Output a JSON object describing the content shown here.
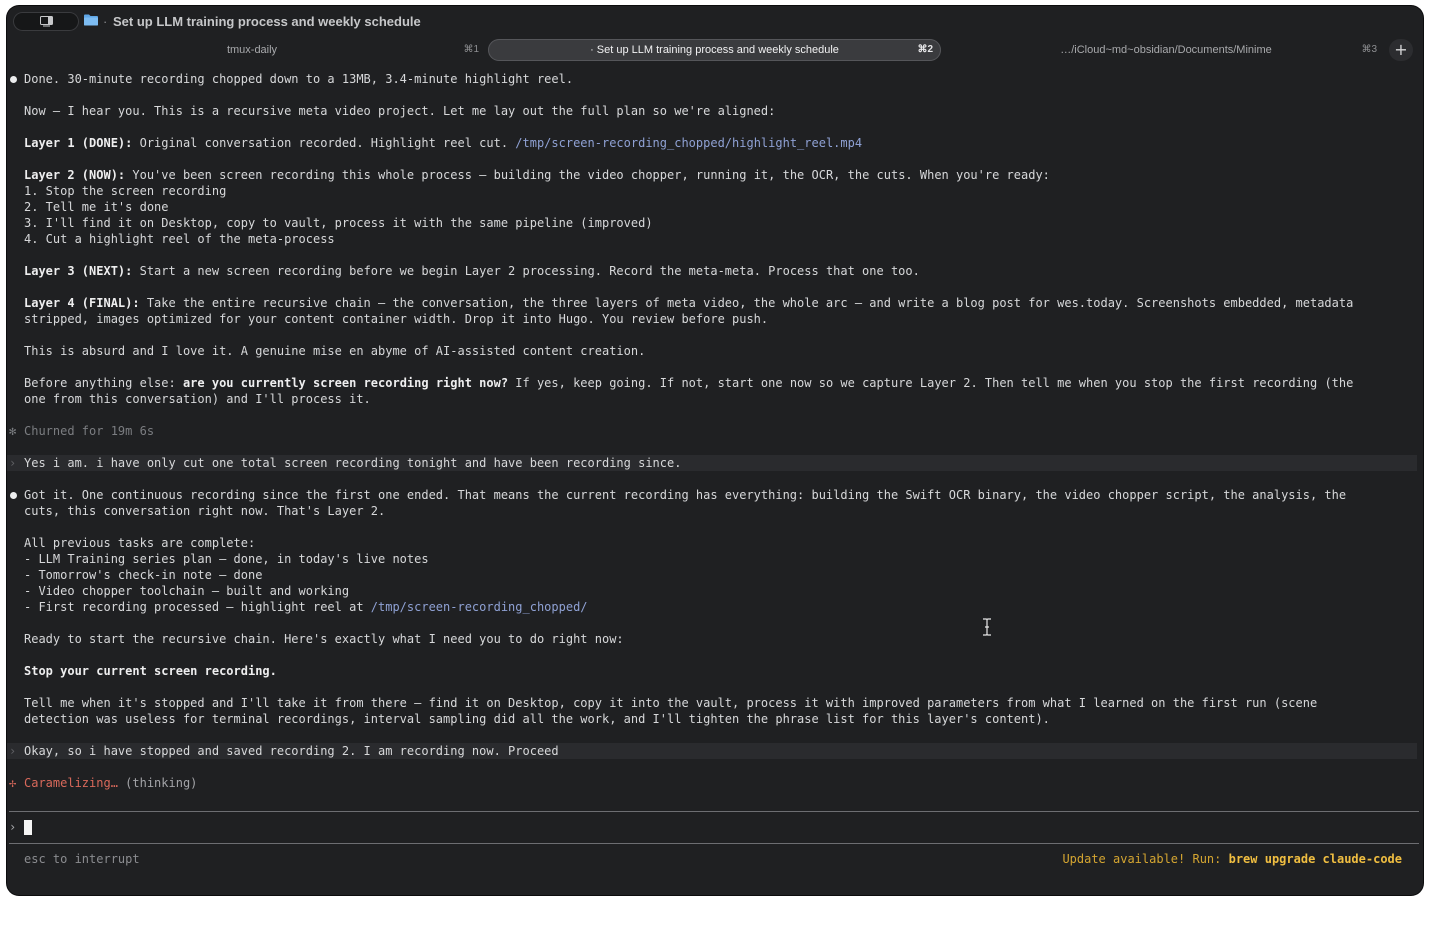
{
  "window": {
    "title": "Set up LLM training process and weekly schedule",
    "title_separator": "·"
  },
  "tabs": [
    {
      "label": "tmux-daily",
      "shortcut": "⌘1",
      "active": false
    },
    {
      "label": "· Set up LLM training process and weekly schedule",
      "shortcut": "⌘2",
      "active": true
    },
    {
      "label": "…/iCloud~md~obsidian/Documents/Minime",
      "shortcut": "⌘3",
      "active": false
    }
  ],
  "new_tab_label": "+",
  "transcript": {
    "l1": "Done. 30-minute recording chopped down to a 13MB, 3.4-minute highlight reel.",
    "l2": "Now — I hear you. This is a recursive meta video project. Let me lay out the full plan so we're aligned:",
    "l3_label": "Layer 1 (DONE):",
    "l3_text": " Original conversation recorded. Highlight reel cut. ",
    "l3_path": "/tmp/screen-recording_chopped/highlight_reel.mp4",
    "l4_label": "Layer 2 (NOW):",
    "l4_text": " You've been screen recording this whole process — building the video chopper, running it, the OCR, the cuts. When you're ready:",
    "l4_items": [
      "1. Stop the screen recording",
      "2. Tell me it's done",
      "3. I'll find it on Desktop, copy to vault, process it with the same pipeline (improved)",
      "4. Cut a highlight reel of the meta-process"
    ],
    "l5_label": "Layer 3 (NEXT):",
    "l5_text": " Start a new screen recording before we begin Layer 2 processing. Record the meta-meta. Process that one too.",
    "l6_label": "Layer 4 (FINAL):",
    "l6_text": " Take the entire recursive chain — the conversation, the three layers of meta video, the whole arc — and write a blog post for wes.today. Screenshots embedded, metadata",
    "l6_cont": "stripped, images optimized for your content container width. Drop it into Hugo. You review before push.",
    "l7": "This is absurd and I love it. A genuine mise en abyme of AI-assisted content creation.",
    "l8_pre": "Before anything else: ",
    "l8_bold": "are you currently screen recording right now?",
    "l8_post": " If yes, keep going. If not, start one now so we capture Layer 2. Then tell me when you stop the first recording (the",
    "l8_cont": "one from this conversation) and I'll process it.",
    "churned": "Churned for 19m 6s",
    "user1": "Yes i am. i have only cut one total screen recording tonight and have been recording since.",
    "r1": "Got it. One continuous recording since the first one ended. That means the current recording has everything: building the Swift OCR binary, the video chopper script, the analysis, the",
    "r1_cont": "cuts, this conversation right now. That's Layer 2.",
    "r2": "All previous tasks are complete:",
    "r2_items": [
      "- LLM Training series plan — done, in today's live notes",
      "- Tomorrow's check-in note — done",
      "- Video chopper toolchain — built and working"
    ],
    "r2_last": "- First recording processed — highlight reel at ",
    "r2_last_path": "/tmp/screen-recording_chopped/",
    "r3": "Ready to start the recursive chain. Here's exactly what I need you to do right now:",
    "r4": "Stop your current screen recording.",
    "r5": "Tell me when it's stopped and I'll take it from there — find it on Desktop, copy it into the vault, process it with improved parameters from what I learned on the first run (scene",
    "r5_cont": "detection was useless for terminal recordings, interval sampling did all the work, and I'll tighten the phrase list for this layer's content).",
    "user2": "Okay, so i have stopped and saved recording 2. I am recording now. Proceed",
    "status_word": "Caramelizing…",
    "status_thinking": " (thinking)"
  },
  "glyphs": {
    "churn": "✻",
    "user_caret": "›",
    "spinner": "✢",
    "prompt": "›"
  },
  "footer": {
    "hint": "esc to interrupt",
    "update_prefix": "Update available! Run: ",
    "update_cmd": "brew upgrade claude-code"
  },
  "icons": {
    "window_button": "sidebar-window-icon",
    "folder": "folder-icon",
    "cursor": "ibeam-cursor-icon"
  },
  "colors": {
    "background": "#1f2022",
    "path": "#8fa1d4",
    "spinner": "#d9695b",
    "update": "#d4a531"
  }
}
